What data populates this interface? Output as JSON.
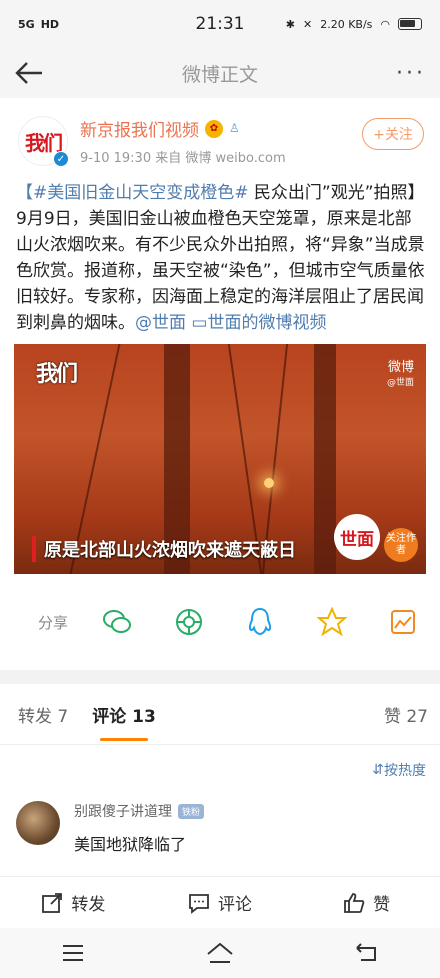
{
  "status": {
    "network_left": "5G",
    "hd": "HD",
    "time": "21:31",
    "speed": "2.20 KB/s"
  },
  "nav": {
    "title": "微博正文",
    "more": "···"
  },
  "post": {
    "author": "新京报我们视频",
    "logo_text": "我们",
    "meta_time": "9-10 19:30",
    "meta_source": "来自 微博 weibo.com",
    "follow_label": "+关注",
    "text_hashtag": "【#美国旧金山天空变成橙色#",
    "text_body": " 民众出门”观光”拍照】9月9日，美国旧金山被血橙色天空笼罩，原来是北部山火浓烟吹来。有不少民众外出拍照，将“异象”当成景色欣赏。报道称，虽天空被“染色”，但城市空气质量依旧较好。专家称，因海面上稳定的海洋层阻止了居民闻到刺鼻的烟味。",
    "mention": "@世面",
    "video_link": "世面的微博视频"
  },
  "video": {
    "logo": "我们",
    "weibo": "微博",
    "weibo_sub": "@世面",
    "subtitle": "原是北部山火浓烟吹来遮天蔽日",
    "shimian": "世面",
    "follow_author": "关注作者"
  },
  "share": {
    "label": "分享",
    "icons": [
      "wechat-icon",
      "moments-icon",
      "qq-icon",
      "qzone-icon",
      "screenshot-share-icon"
    ]
  },
  "tabs": {
    "reposts": "转发 7",
    "comments": "评论 13",
    "likes": "赞 27"
  },
  "sort": {
    "label": "按热度"
  },
  "comment": {
    "user": "别跟傻子讲道理",
    "tag": "铁粉",
    "text": "美国地狱降临了"
  },
  "actions": {
    "repost": "转发",
    "comment": "评论",
    "like": "赞"
  },
  "colors": {
    "accent": "#ff8200",
    "link": "#507daf",
    "author": "#eb7350"
  }
}
